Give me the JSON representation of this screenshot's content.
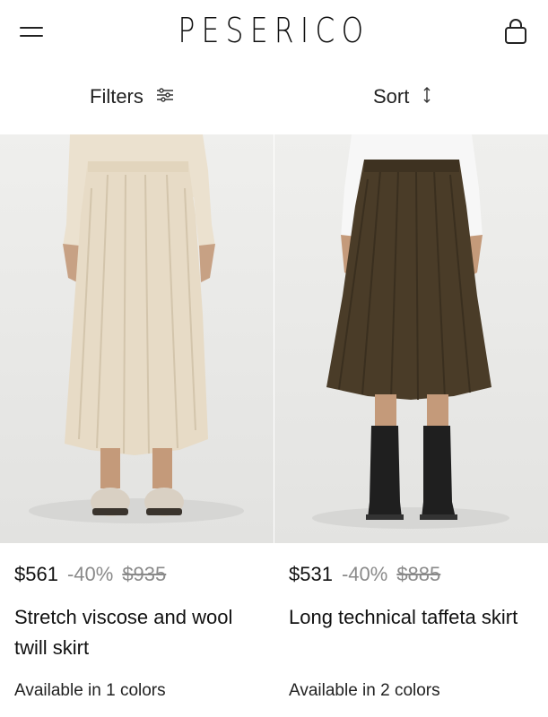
{
  "header": {
    "brand": "PESERICO",
    "menu_icon": "hamburger-menu-icon",
    "bag_icon": "shopping-bag-icon"
  },
  "toolbar": {
    "filters_label": "Filters",
    "filters_icon": "sliders-icon",
    "sort_label": "Sort",
    "sort_icon": "sort-arrows-icon"
  },
  "products": [
    {
      "price": "$561",
      "discount": "-40%",
      "old_price": "$935",
      "name": "Stretch viscose and wool twill skirt",
      "availability": "Available in 1 colors",
      "color": "#e8dcc8"
    },
    {
      "price": "$531",
      "discount": "-40%",
      "old_price": "$885",
      "name": "Long technical taffeta skirt",
      "availability": "Available in 2 colors",
      "color": "#4a3d28"
    }
  ]
}
